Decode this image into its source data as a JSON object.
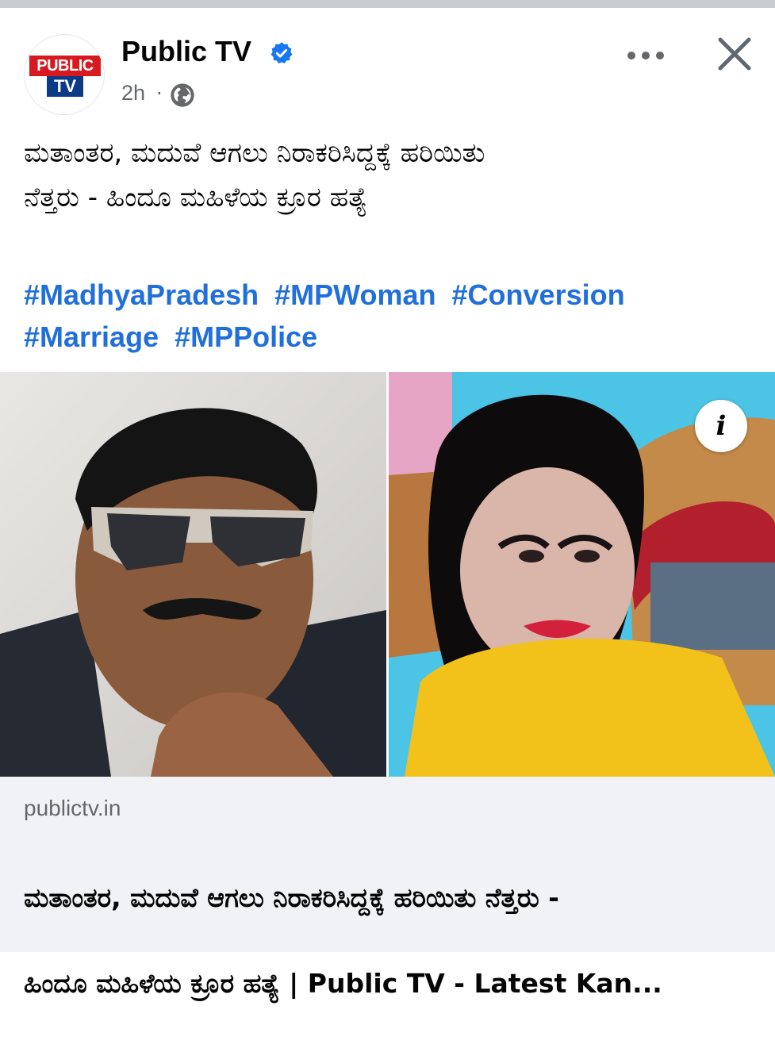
{
  "header": {
    "page_name": "Public TV",
    "avatar_logo_top": "PUBLIC",
    "avatar_logo_bottom": "TV",
    "post_time": "2h",
    "separator": "·",
    "audience_icon": "globe-icon",
    "verified_icon": "verified-badge-icon",
    "more_icon": "more-options-icon",
    "close_icon": "close-icon"
  },
  "post": {
    "text_line1": "ಮತಾಂತರ, ಮದುವೆ ಆಗಲು ನಿರಾಕರಿಸಿದ್ದಕ್ಕೆ ಹರಿಯಿತು",
    "text_line2": "ನೆತ್ತರು - ಹಿಂದೂ ಮಹಿಳೆಯ ಕ್ರೂರ ಹತ್ಯೆ",
    "hashtags": [
      "#MadhyaPradesh",
      "#MPWoman",
      "#Conversion",
      "#Marriage",
      "#MPPolice"
    ]
  },
  "images": {
    "info_label": "i"
  },
  "link_preview": {
    "domain": "publictv.in",
    "title_line1": "ಮತಾಂತರ, ಮದುವೆ ಆಗಲು ನಿರಾಕರಿಸಿದ್ದಕ್ಕೆ ಹರಿಯಿತು ನೆತ್ತರು -",
    "title_line2": "ಹಿಂದೂ ಮಹಿಳೆಯ ಕ್ರೂರ ಹತ್ಯೆ | Public TV - Latest Kan..."
  },
  "colors": {
    "hashtag": "#216fdb",
    "verified": "#1877f2",
    "secondary_text": "#65676b",
    "preview_bg": "#f0f2f5"
  }
}
